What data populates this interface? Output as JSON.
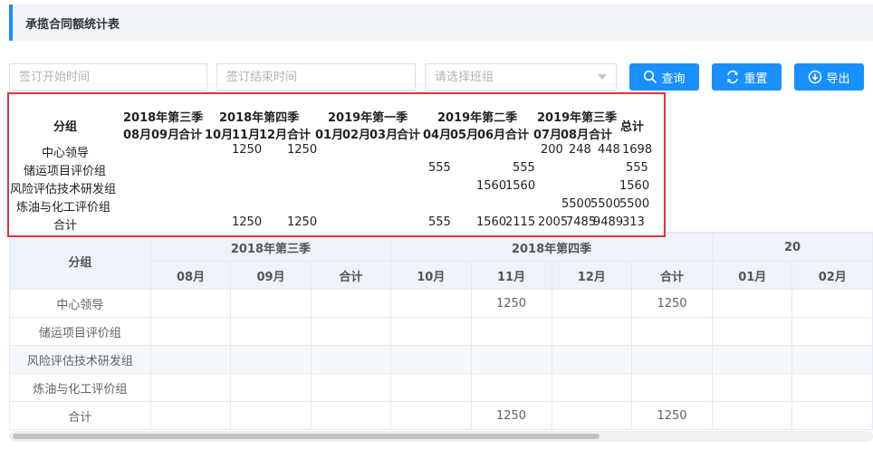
{
  "header": {
    "title": "承揽合同额统计表"
  },
  "filters": {
    "start_placeholder": "签订开始时间",
    "end_placeholder": "签订结束时间",
    "group_placeholder": "请选择班组"
  },
  "buttons": {
    "query": "查询",
    "reset": "重置",
    "export": "导出"
  },
  "popup": {
    "group_header": "分组",
    "total_header": "总计",
    "quarters": [
      "2018年第三季",
      "2018年第四季",
      "2019年第一季",
      "2019年第二季",
      "2019年第三季"
    ],
    "months": [
      "08月",
      "09月",
      "合计",
      "10月",
      "11月",
      "12月",
      "合计",
      "01月",
      "02月",
      "03月",
      "合计",
      "04月",
      "05月",
      "06月",
      "合计",
      "07月",
      "08月",
      "合计"
    ],
    "rows": [
      {
        "name": "中心领导",
        "values": [
          "1250",
          "1250",
          "200",
          "248",
          "448",
          "1698"
        ]
      },
      {
        "name": "储运项目评价组",
        "values": [
          "555",
          "555",
          "555"
        ]
      },
      {
        "name": "风险评估技术研发组",
        "values": [
          "1560",
          "1560",
          "1560"
        ]
      },
      {
        "name": "炼油与化工评价组",
        "values": [
          "5500",
          "5500",
          "5500"
        ]
      },
      {
        "name": "合计",
        "values": [
          "1250",
          "1250",
          "555",
          "1560",
          "2115",
          "2005",
          "7485",
          "9489",
          "313"
        ]
      }
    ]
  },
  "table": {
    "group_header": "分组",
    "quarters": [
      "2018年第三季",
      "2018年第四季",
      "20"
    ],
    "months": [
      "08月",
      "09月",
      "合计",
      "10月",
      "11月",
      "12月",
      "合计",
      "01月",
      "02月"
    ],
    "rows": [
      {
        "name": "中心领导",
        "cells": [
          "",
          "",
          "",
          "",
          "1250",
          "",
          "1250",
          "",
          ""
        ]
      },
      {
        "name": "储运项目评价组",
        "cells": [
          "",
          "",
          "",
          "",
          "",
          "",
          "",
          "",
          ""
        ]
      },
      {
        "name": "风险评估技术研发组",
        "cells": [
          "",
          "",
          "",
          "",
          "",
          "",
          "",
          "",
          ""
        ]
      },
      {
        "name": "炼油与化工评价组",
        "cells": [
          "",
          "",
          "",
          "",
          "",
          "",
          "",
          "",
          ""
        ]
      },
      {
        "name": "合计",
        "cells": [
          "",
          "",
          "",
          "",
          "1250",
          "",
          "1250",
          "",
          ""
        ]
      }
    ]
  }
}
